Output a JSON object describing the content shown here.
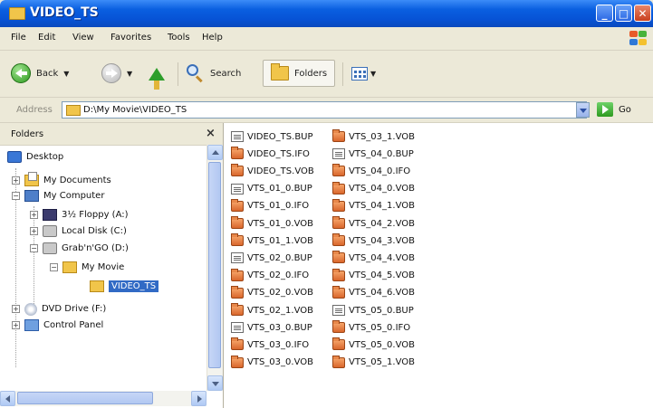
{
  "window": {
    "title": "VIDEO_TS",
    "controls": {
      "minimize": "_",
      "maximize": "□",
      "close": "✕"
    }
  },
  "menubar": {
    "items": [
      "File",
      "Edit",
      "View",
      "Favorites",
      "Tools",
      "Help"
    ]
  },
  "toolbar": {
    "back_label": "Back",
    "search_label": "Search",
    "folders_label": "Folders"
  },
  "address": {
    "label": "Address",
    "value": "D:\\My Movie\\VIDEO_TS",
    "go_label": "Go"
  },
  "folders_pane": {
    "title": "Folders",
    "close_glyph": "×",
    "tree": [
      {
        "label": "Desktop",
        "icon": "desktop-icon"
      },
      {
        "label": "My Documents",
        "icon": "my-documents-icon",
        "expander": "+"
      },
      {
        "label": "My Computer",
        "icon": "computer-icon",
        "expander": "−"
      },
      {
        "label": "3½ Floppy (A:)",
        "icon": "floppy-icon",
        "expander": "+"
      },
      {
        "label": "Local Disk (C:)",
        "icon": "disk-icon",
        "expander": "+"
      },
      {
        "label": "Grab'n'GO (D:)",
        "icon": "disk-icon",
        "expander": "−"
      },
      {
        "label": "My Movie",
        "icon": "folder-icon",
        "expander": "−"
      },
      {
        "label": "VIDEO_TS",
        "icon": "folder-open-icon",
        "selected": true
      },
      {
        "label": "DVD Drive (F:)",
        "icon": "dvd-icon",
        "expander": "+"
      },
      {
        "label": "Control Panel",
        "icon": "control-panel-icon",
        "expander": "+"
      }
    ]
  },
  "files": {
    "column1": [
      {
        "name": "VIDEO_TS.BUP",
        "type": "doc"
      },
      {
        "name": "VIDEO_TS.IFO",
        "type": "vob"
      },
      {
        "name": "VIDEO_TS.VOB",
        "type": "vob"
      },
      {
        "name": "VTS_01_0.BUP",
        "type": "doc"
      },
      {
        "name": "VTS_01_0.IFO",
        "type": "vob"
      },
      {
        "name": "VTS_01_0.VOB",
        "type": "vob"
      },
      {
        "name": "VTS_01_1.VOB",
        "type": "vob"
      },
      {
        "name": "VTS_02_0.BUP",
        "type": "doc"
      },
      {
        "name": "VTS_02_0.IFO",
        "type": "vob"
      },
      {
        "name": "VTS_02_0.VOB",
        "type": "vob"
      },
      {
        "name": "VTS_02_1.VOB",
        "type": "vob"
      },
      {
        "name": "VTS_03_0.BUP",
        "type": "doc"
      },
      {
        "name": "VTS_03_0.IFO",
        "type": "vob"
      },
      {
        "name": "VTS_03_0.VOB",
        "type": "vob"
      }
    ],
    "column2": [
      {
        "name": "VTS_03_1.VOB",
        "type": "vob"
      },
      {
        "name": "VTS_04_0.BUP",
        "type": "doc"
      },
      {
        "name": "VTS_04_0.IFO",
        "type": "vob"
      },
      {
        "name": "VTS_04_0.VOB",
        "type": "vob"
      },
      {
        "name": "VTS_04_1.VOB",
        "type": "vob"
      },
      {
        "name": "VTS_04_2.VOB",
        "type": "vob"
      },
      {
        "name": "VTS_04_3.VOB",
        "type": "vob"
      },
      {
        "name": "VTS_04_4.VOB",
        "type": "vob"
      },
      {
        "name": "VTS_04_5.VOB",
        "type": "vob"
      },
      {
        "name": "VTS_04_6.VOB",
        "type": "vob"
      },
      {
        "name": "VTS_05_0.BUP",
        "type": "doc"
      },
      {
        "name": "VTS_05_0.IFO",
        "type": "vob"
      },
      {
        "name": "VTS_05_0.VOB",
        "type": "vob"
      },
      {
        "name": "VTS_05_1.VOB",
        "type": "vob"
      }
    ]
  },
  "colors": {
    "titlebar": "#0753D6",
    "selection": "#316AC5",
    "chrome": "#ECE9D8"
  }
}
